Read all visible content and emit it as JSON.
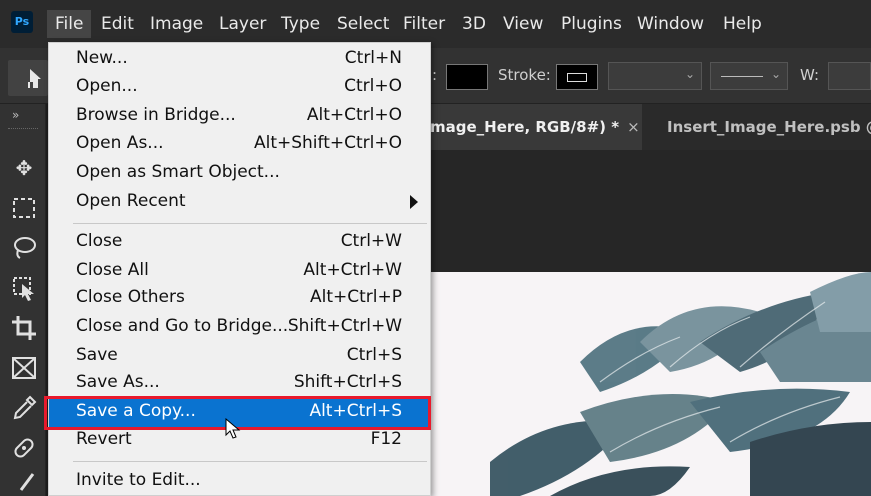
{
  "app": {
    "logo": "Ps"
  },
  "menubar": {
    "items": [
      "File",
      "Edit",
      "Image",
      "Layer",
      "Type",
      "Select",
      "Filter",
      "3D",
      "View",
      "Plugins",
      "Window",
      "Help"
    ]
  },
  "options": {
    "fill_label_partial": ":",
    "stroke_label": "Stroke:",
    "width_label": "W:"
  },
  "toolbar": {
    "collapse_glyph": "»"
  },
  "tabs": [
    {
      "label": "mage_Here, RGB/8#) *",
      "close": "×"
    },
    {
      "label": "Insert_Image_Here.psb @"
    }
  ],
  "file_menu": {
    "items": [
      {
        "label": "New...",
        "shortcut": "Ctrl+N"
      },
      {
        "label": "Open...",
        "shortcut": "Ctrl+O"
      },
      {
        "label": "Browse in Bridge...",
        "shortcut": "Alt+Ctrl+O"
      },
      {
        "label": "Open As...",
        "shortcut": "Alt+Shift+Ctrl+O"
      },
      {
        "label": "Open as Smart Object...",
        "shortcut": ""
      },
      {
        "label": "Open Recent",
        "shortcut": ""
      },
      {
        "label": "Close",
        "shortcut": "Ctrl+W"
      },
      {
        "label": "Close All",
        "shortcut": "Alt+Ctrl+W"
      },
      {
        "label": "Close Others",
        "shortcut": "Alt+Ctrl+P"
      },
      {
        "label": "Close and Go to Bridge...",
        "shortcut": "Shift+Ctrl+W"
      },
      {
        "label": "Save",
        "shortcut": "Ctrl+S"
      },
      {
        "label": "Save As...",
        "shortcut": "Shift+Ctrl+S"
      },
      {
        "label": "Save a Copy...",
        "shortcut": "Alt+Ctrl+S"
      },
      {
        "label": "Revert",
        "shortcut": "F12"
      },
      {
        "label": "Invite to Edit...",
        "shortcut": ""
      }
    ],
    "highlighted_index": 12,
    "highlight_color": "#0a73d0",
    "outline_color": "#e8192c"
  }
}
